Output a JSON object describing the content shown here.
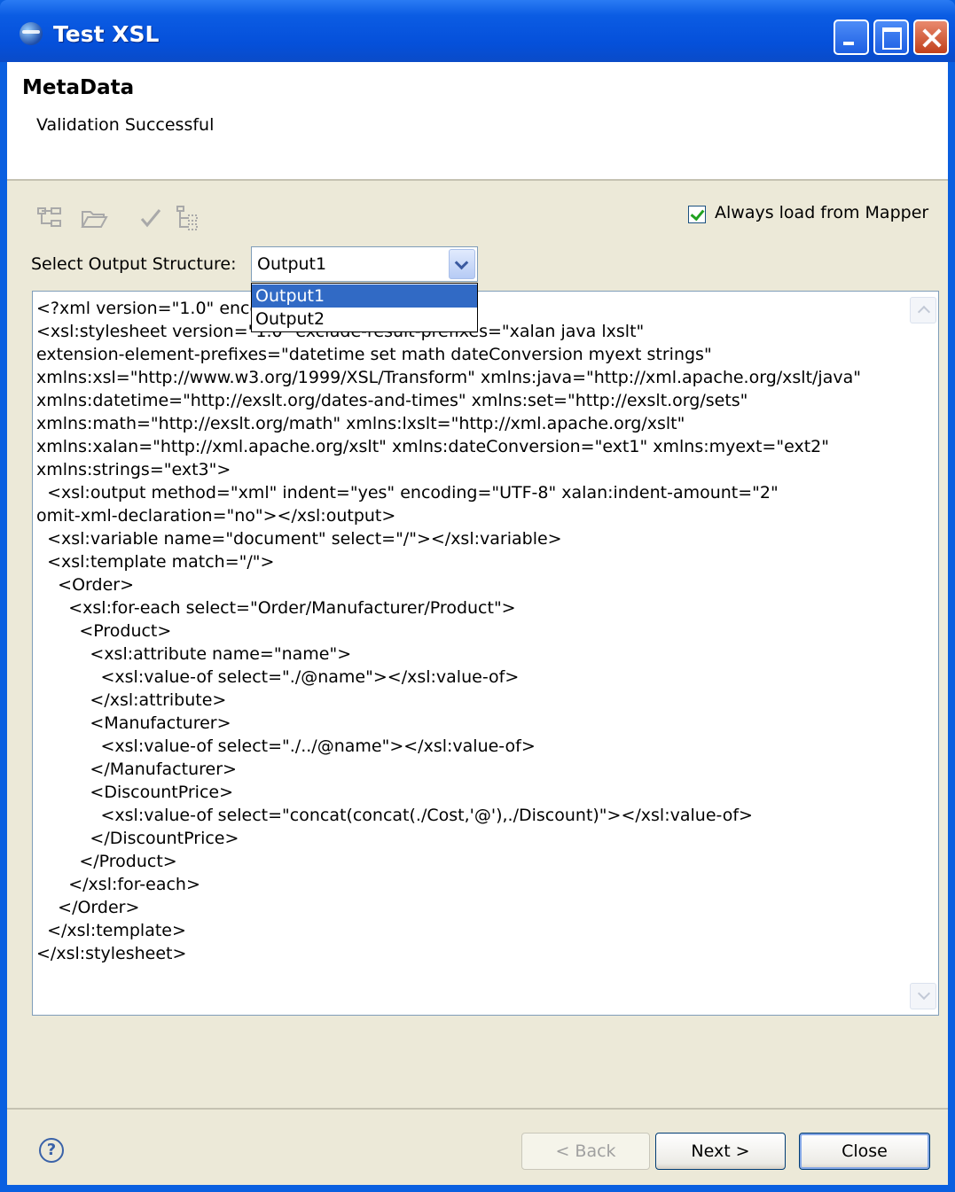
{
  "window": {
    "title": "Test XSL"
  },
  "header": {
    "title": "MetaData",
    "message": "Validation Successful"
  },
  "toolbar": {
    "icons": [
      "tree-icon",
      "folder-open-icon",
      "check-icon",
      "tree-select-icon"
    ],
    "always_load_label": "Always load from Mapper",
    "always_load_checked": true
  },
  "output_select": {
    "label": "Select Output Structure:",
    "value": "Output1",
    "options": [
      "Output1",
      "Output2"
    ]
  },
  "editor": {
    "code": "<?xml version=\"1.0\" enco\n<xsl:stylesheet version=\"1.0\" exclude-result-prefixes=\"xalan java lxslt\"\nextension-element-prefixes=\"datetime set math dateConversion myext strings\"\nxmlns:xsl=\"http://www.w3.org/1999/XSL/Transform\" xmlns:java=\"http://xml.apache.org/xslt/java\"\nxmlns:datetime=\"http://exslt.org/dates-and-times\" xmlns:set=\"http://exslt.org/sets\"\nxmlns:math=\"http://exslt.org/math\" xmlns:lxslt=\"http://xml.apache.org/xslt\"\nxmlns:xalan=\"http://xml.apache.org/xslt\" xmlns:dateConversion=\"ext1\" xmlns:myext=\"ext2\"\nxmlns:strings=\"ext3\">\n  <xsl:output method=\"xml\" indent=\"yes\" encoding=\"UTF-8\" xalan:indent-amount=\"2\"\nomit-xml-declaration=\"no\"></xsl:output>\n  <xsl:variable name=\"document\" select=\"/\"></xsl:variable>\n  <xsl:template match=\"/\">\n    <Order>\n      <xsl:for-each select=\"Order/Manufacturer/Product\">\n        <Product>\n          <xsl:attribute name=\"name\">\n            <xsl:value-of select=\"./@name\"></xsl:value-of>\n          </xsl:attribute>\n          <Manufacturer>\n            <xsl:value-of select=\"./../@name\"></xsl:value-of>\n          </Manufacturer>\n          <DiscountPrice>\n            <xsl:value-of select=\"concat(concat(./Cost,'@'),./Discount)\"></xsl:value-of>\n          </DiscountPrice>\n        </Product>\n      </xsl:for-each>\n    </Order>\n  </xsl:template>\n</xsl:stylesheet>"
  },
  "buttons": {
    "back": "< Back",
    "next": "Next >",
    "close": "Close",
    "help": "?"
  }
}
